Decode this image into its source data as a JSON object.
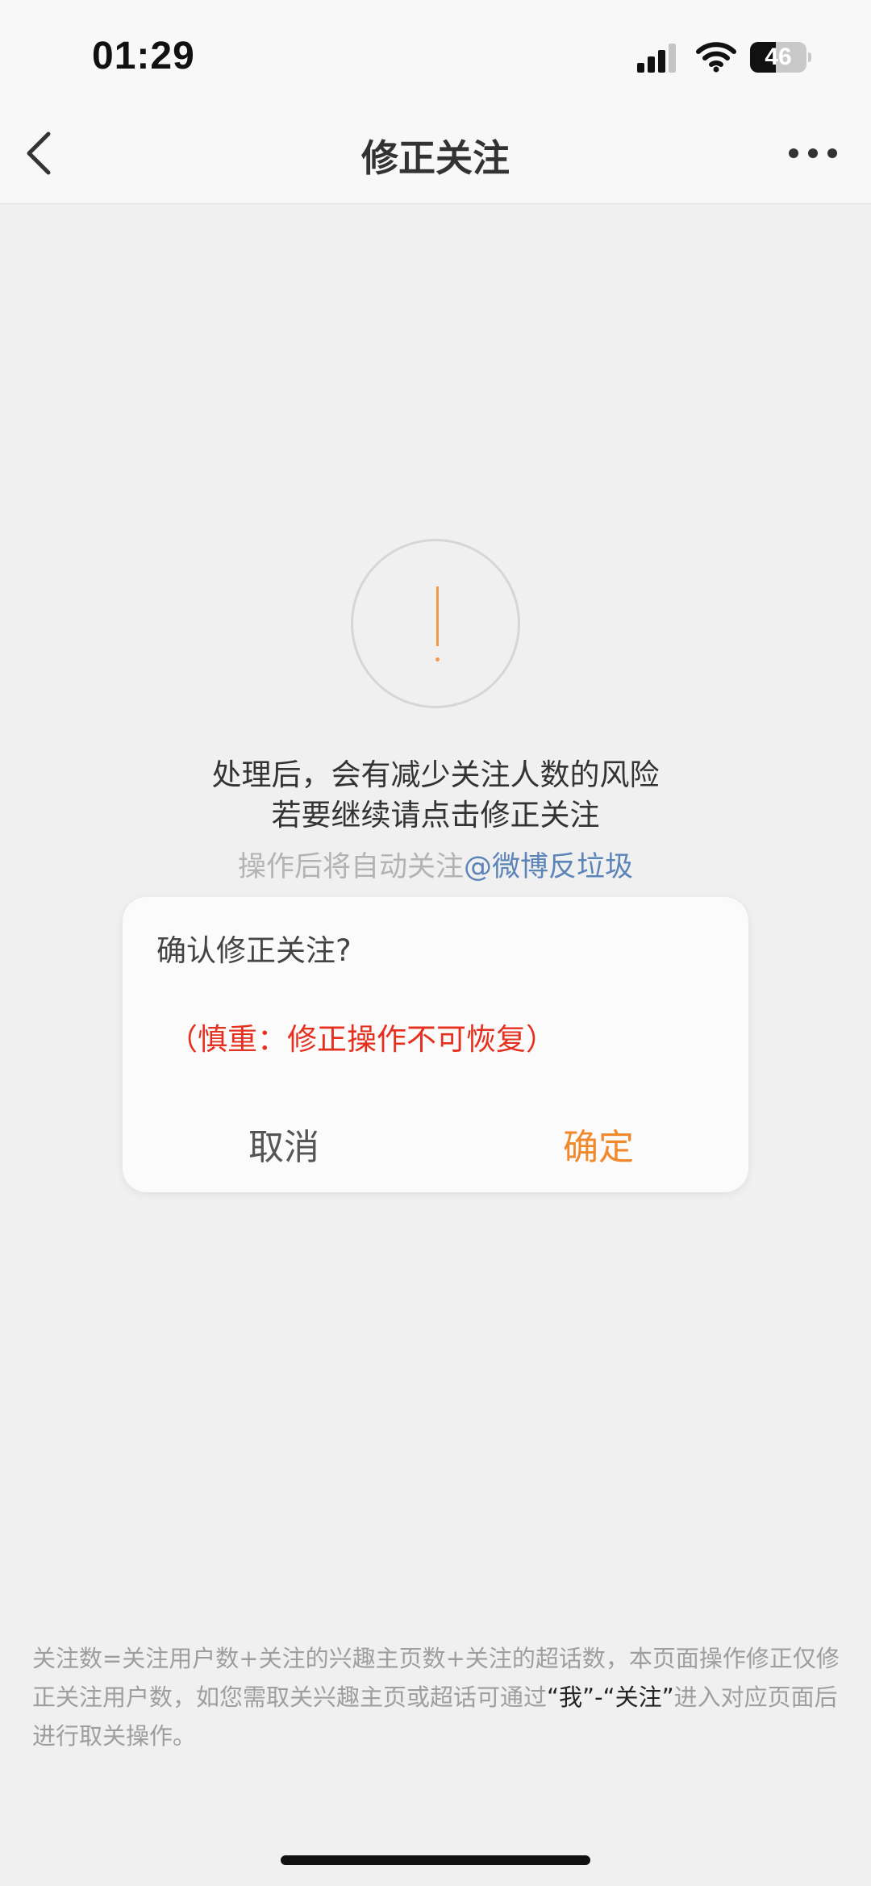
{
  "status_bar": {
    "time": "01:29",
    "battery": "46",
    "battery_level": 0.46
  },
  "nav": {
    "title": "修正关注",
    "back_icon": "chevron-left-icon",
    "more_icon": "ellipsis-icon"
  },
  "content": {
    "warning_icon": "exclamation-circle-icon",
    "accent_color": "#f19a4c",
    "risk_line_1": "处理后，会有减少关注人数的风险",
    "risk_line_2": "若要继续请点击修正关注",
    "auto_follow_prefix": "操作后将自动关注",
    "auto_follow_link": "@微博反垃圾"
  },
  "dialog": {
    "title": "确认修正关注?",
    "warning": "（慎重：修正操作不可恢复）",
    "warning_color": "#e5301f",
    "cancel_label": "取消",
    "confirm_label": "确定",
    "confirm_color": "#f0892b"
  },
  "footer": {
    "note_part_1": "关注数=关注用户数+关注的兴趣主页数+关注的超话数，本页面操作修正仅修正关注用户数，如您需取关兴趣主页或超话可通过",
    "note_me": "“我”",
    "note_dash": "-",
    "note_follow": "“关注”",
    "note_part_2": "进入对应页面后进行取关操作。"
  }
}
